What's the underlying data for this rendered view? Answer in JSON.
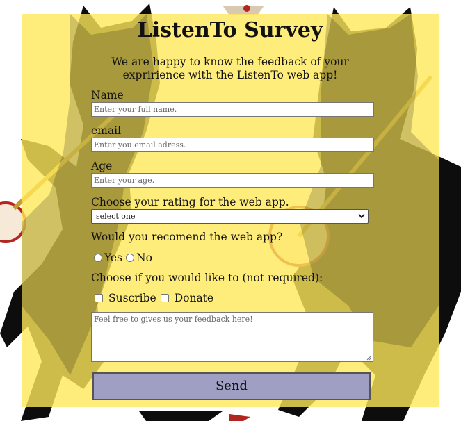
{
  "form": {
    "title": "ListenTo Survey",
    "subtitle": "We are happy to know the feedback of your expririence with the ListenTo web app!",
    "name": {
      "label": "Name",
      "placeholder": "Enter your full name."
    },
    "email": {
      "label": "email",
      "placeholder": "Enter you email adress."
    },
    "age": {
      "label": "Age",
      "placeholder": "Enter your age."
    },
    "rating": {
      "label": "Choose your rating for the web app.",
      "selected": "select one"
    },
    "recommend": {
      "label": "Would you recomend the web app?",
      "options": [
        "Yes",
        "No"
      ]
    },
    "extras": {
      "label": "Choose if you would like to (not required):",
      "options": [
        "Suscribe",
        "Donate"
      ]
    },
    "feedback": {
      "placeholder": "Feel free to gives us your feedback here!"
    },
    "send_label": "Send"
  },
  "colors": {
    "panel": "#ffe95a",
    "button": "#9e9fc3",
    "art_dark": "#111111",
    "art_banjo": "#e3b23c"
  },
  "icons": {
    "select_arrow": "chevron-down-icon",
    "resize": "resize-grip-icon"
  }
}
